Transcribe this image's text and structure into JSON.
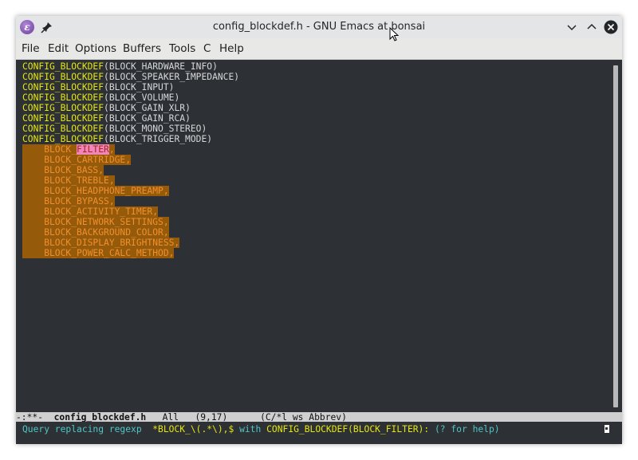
{
  "window": {
    "title": "config_blockdef.h - GNU Emacs at bonsai"
  },
  "menubar": {
    "items": [
      "File",
      "Edit",
      "Options",
      "Buffers",
      "Tools",
      "C",
      "Help"
    ]
  },
  "editor": {
    "lines": [
      {
        "macro": "CONFIG_BLOCKDEF",
        "arg": "BLOCK_HARDWARE_INFO"
      },
      {
        "macro": "CONFIG_BLOCKDEF",
        "arg": "BLOCK_SPEAKER_IMPEDANCE"
      },
      {
        "macro": "CONFIG_BLOCKDEF",
        "arg": "BLOCK_INPUT"
      },
      {
        "macro": "CONFIG_BLOCKDEF",
        "arg": "BLOCK_VOLUME"
      },
      {
        "macro": "CONFIG_BLOCKDEF",
        "arg": "BLOCK_GAIN_XLR"
      },
      {
        "macro": "CONFIG_BLOCKDEF",
        "arg": "BLOCK_GAIN_RCA"
      },
      {
        "macro": "CONFIG_BLOCKDEF",
        "arg": "BLOCK_MONO_STEREO"
      },
      {
        "macro": "CONFIG_BLOCKDEF",
        "arg": "BLOCK_TRIGGER_MODE"
      }
    ],
    "region_lines": [
      {
        "prefix": "    BLOCK_",
        "match": "FILTER",
        "suffix": ","
      },
      {
        "prefix": "    BLOCK_CARTRIDGE,",
        "match": "",
        "suffix": ""
      },
      {
        "prefix": "    BLOCK_BASS,",
        "match": "",
        "suffix": ""
      },
      {
        "prefix": "    BLOCK_TREBLE,",
        "match": "",
        "suffix": ""
      },
      {
        "prefix": "    BLOCK_HEADPHONE_PREAMP,",
        "match": "",
        "suffix": ""
      },
      {
        "prefix": "    BLOCK_BYPASS,",
        "match": "",
        "suffix": ""
      },
      {
        "prefix": "    BLOCK_ACTIVITY_TIMER,",
        "match": "",
        "suffix": ""
      },
      {
        "prefix": "    BLOCK_NETWORK_SETTINGS,",
        "match": "",
        "suffix": ""
      },
      {
        "prefix": "    BLOCK_BACKGROUND_COLOR,",
        "match": "",
        "suffix": ""
      },
      {
        "prefix": "    BLOCK_DISPLAY_BRIGHTNESS,",
        "match": "",
        "suffix": ""
      },
      {
        "prefix": "    BLOCK_POWER_CALC_METHOD,",
        "match": "",
        "suffix": ""
      }
    ]
  },
  "modeline": {
    "status": "-:**-  ",
    "buffer": "config_blockdef.h",
    "position": "All",
    "line_col": "(9,17)",
    "modes": "(C/*l ws Abbrev)"
  },
  "minibuffer": {
    "prompt": "Query replacing regexp ",
    "regexp": " *BLOCK_\\(.*\\),$",
    "with_label": "with",
    "replacement": "CONFIG_BLOCKDEF(BLOCK_FILTER):",
    "help": "(? for help)"
  },
  "colors": {
    "background": "#2d3135",
    "macro": "#e6e60f",
    "region_bg": "#955a0a",
    "region_fg": "#f08f2c",
    "match_bg": "#f087b8",
    "prompt": "#4fc7c7"
  }
}
